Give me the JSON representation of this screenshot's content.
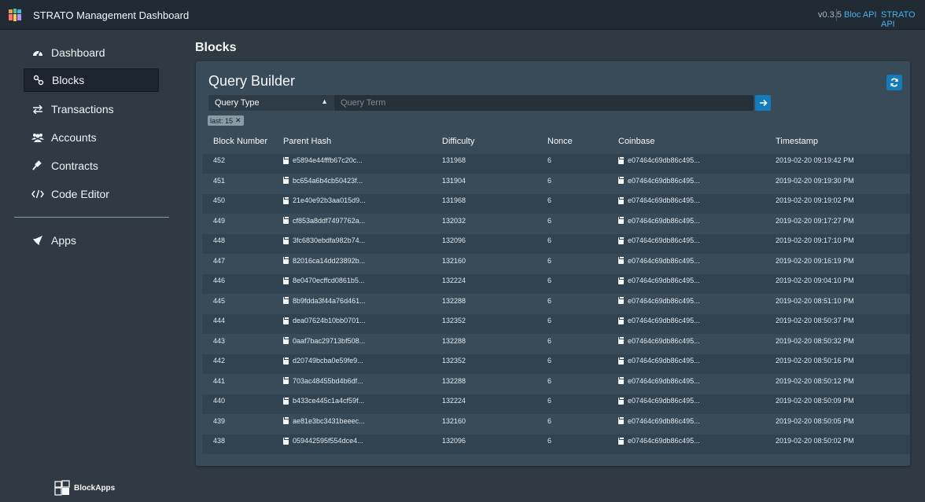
{
  "topbar": {
    "title": "STRATO Management Dashboard",
    "version": "v0.3.5",
    "links": [
      "Bloc API",
      "STRATO API"
    ]
  },
  "sidebar": {
    "items": [
      {
        "label": "Dashboard",
        "icon": "dashboard-icon"
      },
      {
        "label": "Blocks",
        "icon": "blocks-icon",
        "active": true
      },
      {
        "label": "Transactions",
        "icon": "exchange-icon"
      },
      {
        "label": "Accounts",
        "icon": "users-icon"
      },
      {
        "label": "Contracts",
        "icon": "gavel-icon"
      },
      {
        "label": "Code Editor",
        "icon": "code-icon"
      },
      {
        "label": "Apps",
        "icon": "rocket-icon"
      }
    ],
    "footer": "BlockApps"
  },
  "page": {
    "title": "Blocks"
  },
  "query_builder": {
    "title": "Query Builder",
    "query_type": "Query Type",
    "query_term_placeholder": "Query Term",
    "tags": [
      {
        "label": "last: 15"
      }
    ]
  },
  "table": {
    "headers": [
      "Block Number",
      "Parent Hash",
      "Difficulty",
      "Nonce",
      "Coinbase",
      "Timestamp"
    ],
    "rows": [
      {
        "number": "452",
        "parent": "e5894e44fffb67c20c...",
        "difficulty": "131968",
        "nonce": "6",
        "coinbase": "e07464c69db86c495...",
        "timestamp": "2019-02-20 09:19:42 PM"
      },
      {
        "number": "451",
        "parent": "bc654a6b4cb50423f...",
        "difficulty": "131904",
        "nonce": "6",
        "coinbase": "e07464c69db86c495...",
        "timestamp": "2019-02-20 09:19:30 PM"
      },
      {
        "number": "450",
        "parent": "21e40e92b3aa015d9...",
        "difficulty": "131968",
        "nonce": "6",
        "coinbase": "e07464c69db86c495...",
        "timestamp": "2019-02-20 09:19:02 PM"
      },
      {
        "number": "449",
        "parent": "cf853a8ddf7497762a...",
        "difficulty": "132032",
        "nonce": "6",
        "coinbase": "e07464c69db86c495...",
        "timestamp": "2019-02-20 09:17:27 PM"
      },
      {
        "number": "448",
        "parent": "3fc6830ebdfa982b74...",
        "difficulty": "132096",
        "nonce": "6",
        "coinbase": "e07464c69db86c495...",
        "timestamp": "2019-02-20 09:17:10 PM"
      },
      {
        "number": "447",
        "parent": "82016ca14dd23892b...",
        "difficulty": "132160",
        "nonce": "6",
        "coinbase": "e07464c69db86c495...",
        "timestamp": "2019-02-20 09:16:19 PM"
      },
      {
        "number": "446",
        "parent": "8e0470ecffcd0861b5...",
        "difficulty": "132224",
        "nonce": "6",
        "coinbase": "e07464c69db86c495...",
        "timestamp": "2019-02-20 09:04:10 PM"
      },
      {
        "number": "445",
        "parent": "8b9fdda3f44a76d461...",
        "difficulty": "132288",
        "nonce": "6",
        "coinbase": "e07464c69db86c495...",
        "timestamp": "2019-02-20 08:51:10 PM"
      },
      {
        "number": "444",
        "parent": "dea07624b10bb0701...",
        "difficulty": "132352",
        "nonce": "6",
        "coinbase": "e07464c69db86c495...",
        "timestamp": "2019-02-20 08:50:37 PM"
      },
      {
        "number": "443",
        "parent": "0aaf7bac29713bf508...",
        "difficulty": "132288",
        "nonce": "6",
        "coinbase": "e07464c69db86c495...",
        "timestamp": "2019-02-20 08:50:32 PM"
      },
      {
        "number": "442",
        "parent": "d20749bcba0e59fe9...",
        "difficulty": "132352",
        "nonce": "6",
        "coinbase": "e07464c69db86c495...",
        "timestamp": "2019-02-20 08:50:16 PM"
      },
      {
        "number": "441",
        "parent": "703ac48455bd4b6df...",
        "difficulty": "132288",
        "nonce": "6",
        "coinbase": "e07464c69db86c495...",
        "timestamp": "2019-02-20 08:50:12 PM"
      },
      {
        "number": "440",
        "parent": "b433ce445c1a4cf59f...",
        "difficulty": "132224",
        "nonce": "6",
        "coinbase": "e07464c69db86c495...",
        "timestamp": "2019-02-20 08:50:09 PM"
      },
      {
        "number": "439",
        "parent": "ae81e3bc3431beeec...",
        "difficulty": "132160",
        "nonce": "6",
        "coinbase": "e07464c69db86c495...",
        "timestamp": "2019-02-20 08:50:05 PM"
      },
      {
        "number": "438",
        "parent": "059442595f554dce4...",
        "difficulty": "132096",
        "nonce": "6",
        "coinbase": "e07464c69db86c495...",
        "timestamp": "2019-02-20 08:50:02 PM"
      }
    ]
  },
  "colors": {
    "background": "#2f3a45",
    "topbar": "#202b33",
    "card": "#394b59",
    "accent": "#137cbd",
    "link": "#48aff0"
  }
}
